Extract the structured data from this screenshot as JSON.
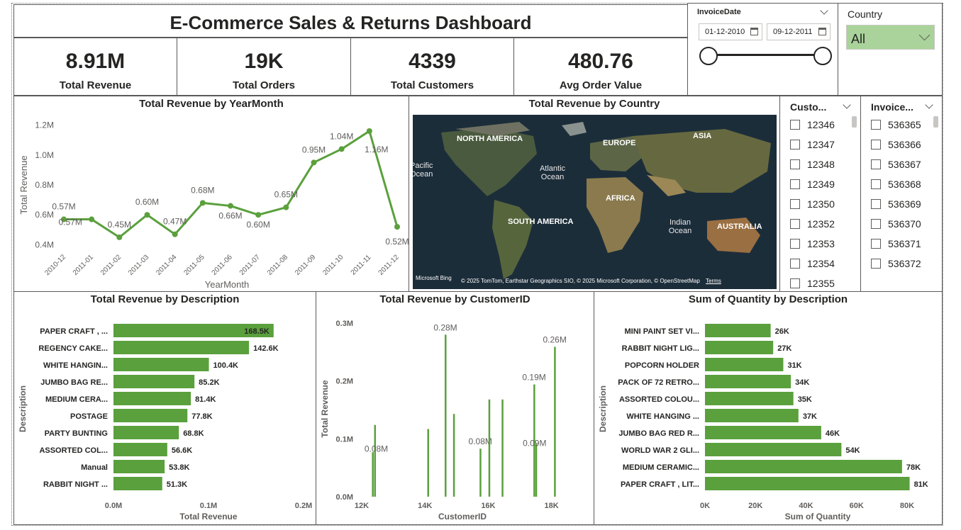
{
  "dashboard": {
    "title": "E-Commerce Sales & Returns Dashboard",
    "accent_color": "#5aa03c",
    "kpis": [
      {
        "value": "8.91M",
        "label": "Total Revenue"
      },
      {
        "value": "19K",
        "label": "Total Orders"
      },
      {
        "value": "4339",
        "label": "Total Customers"
      },
      {
        "value": "480.76",
        "label": "Avg Order Value"
      }
    ]
  },
  "slicers": {
    "invoice_date": {
      "label": "InvoiceDate",
      "start": "01-12-2010",
      "end": "09-12-2011",
      "icon": "calendar-icon",
      "range_fraction": [
        0,
        1
      ]
    },
    "country": {
      "label": "Country",
      "selected": "All",
      "icon": "chevron-down-icon"
    },
    "customer": {
      "label": "Custo...",
      "items": [
        "12346",
        "12347",
        "12348",
        "12349",
        "12350",
        "12352",
        "12353",
        "12354",
        "12355"
      ]
    },
    "invoice": {
      "label": "Invoice...",
      "items": [
        "536365",
        "536366",
        "536367",
        "536368",
        "536369",
        "536370",
        "536371",
        "536372"
      ]
    }
  },
  "map": {
    "title": "Total Revenue by Country",
    "labels": [
      "NORTH AMERICA",
      "EUROPE",
      "ASIA",
      "Pacific Ocean",
      "Atlantic Ocean",
      "AFRICA",
      "SOUTH AMERICA",
      "Indian Ocean",
      "AUSTRALIA"
    ],
    "brand": "Microsoft Bing",
    "attribution": "© 2025 TomTom, Earthstar Geographics SIO, © 2025 Microsoft Corporation, © OpenStreetMap",
    "terms": "Terms"
  },
  "chart_data": [
    {
      "type": "line",
      "title": "Total Revenue by YearMonth",
      "xlabel": "YearMonth",
      "ylabel": "Total Revenue",
      "categories": [
        "2010-12",
        "2011-01",
        "2011-02",
        "2011-03",
        "2011-04",
        "2011-05",
        "2011-06",
        "2011-07",
        "2011-08",
        "2011-09",
        "2011-10",
        "2011-11",
        "2011-12"
      ],
      "values": [
        0.57,
        0.57,
        0.45,
        0.6,
        0.47,
        0.68,
        0.66,
        0.6,
        0.65,
        0.95,
        1.04,
        1.16,
        0.52
      ],
      "data_labels": [
        "0.57M",
        "0.57M",
        "0.45M",
        "0.60M",
        "0.47M",
        "0.68M",
        "0.66M",
        "0.60M",
        "0.65M",
        "0.95M",
        "1.04M",
        "1.16M",
        "0.52M"
      ],
      "yticks": [
        "0.4M",
        "0.6M",
        "0.8M",
        "1.0M",
        "1.2M"
      ],
      "ytick_values": [
        0.4,
        0.6,
        0.8,
        1.0,
        1.2
      ],
      "ylim": [
        0.35,
        1.25
      ],
      "color": "#5aa03c"
    },
    {
      "type": "bar",
      "orientation": "horizontal",
      "title": "Total Revenue by Description",
      "xlabel": "Total Revenue",
      "ylabel": "Description",
      "categories": [
        "PAPER CRAFT , ...",
        "REGENCY CAKE...",
        "WHITE HANGIN...",
        "JUMBO BAG RE...",
        "MEDIUM CERA...",
        "POSTAGE",
        "PARTY BUNTING",
        "ASSORTED COL...",
        "Manual",
        "RABBIT NIGHT ..."
      ],
      "values": [
        168.5,
        142.6,
        100.4,
        85.2,
        81.4,
        77.8,
        68.8,
        56.6,
        53.8,
        51.3
      ],
      "value_unit": "K",
      "data_labels": [
        "168.5K",
        "142.6K",
        "100.4K",
        "85.2K",
        "81.4K",
        "77.8K",
        "68.8K",
        "56.6K",
        "53.8K",
        "51.3K"
      ],
      "xticks": [
        "0.0M",
        "0.1M",
        "0.2M"
      ],
      "xtick_values": [
        0,
        100,
        200
      ],
      "xlim": [
        0,
        200
      ],
      "color": "#5aa03c"
    },
    {
      "type": "bar",
      "title": "Total Revenue by CustomerID",
      "xlabel": "CustomerID",
      "ylabel": "Total Revenue",
      "x": [
        12346,
        12415,
        14096,
        14646,
        14911,
        15749,
        16029,
        16446,
        17450,
        17511,
        18102
      ],
      "values": [
        0.077,
        0.124,
        0.117,
        0.28,
        0.143,
        0.083,
        0.168,
        0.168,
        0.194,
        0.091,
        0.259
      ],
      "data_labels": [
        "",
        "0.08M",
        "",
        "0.28M",
        "",
        "0.08M",
        "",
        "",
        "0.19M",
        "0.09M",
        "0.26M"
      ],
      "xticks": [
        "12K",
        "14K",
        "16K",
        "18K"
      ],
      "xtick_values": [
        12000,
        14000,
        16000,
        18000
      ],
      "yticks": [
        "0.0M",
        "0.1M",
        "0.2M",
        "0.3M"
      ],
      "ytick_values": [
        0,
        0.1,
        0.2,
        0.3
      ],
      "xlim": [
        12000,
        18300
      ],
      "ylim": [
        0,
        0.3
      ],
      "color": "#5aa03c"
    },
    {
      "type": "bar",
      "orientation": "horizontal",
      "title": "Sum of Quantity by Description",
      "xlabel": "Sum of Quantity",
      "ylabel": "Description",
      "categories": [
        "MINI PAINT SET VI...",
        "RABBIT NIGHT LIG...",
        "POPCORN HOLDER",
        "PACK OF 72 RETRO...",
        "ASSORTED COLOU...",
        "WHITE HANGING ...",
        "JUMBO BAG RED R...",
        "WORLD WAR 2 GLI...",
        "MEDIUM CERAMIC...",
        "PAPER CRAFT , LIT..."
      ],
      "values": [
        26,
        27,
        31,
        34,
        35,
        37,
        46,
        54,
        78,
        81
      ],
      "value_unit": "K",
      "data_labels": [
        "26K",
        "27K",
        "31K",
        "34K",
        "35K",
        "37K",
        "46K",
        "54K",
        "78K",
        "81K"
      ],
      "xticks": [
        "0K",
        "20K",
        "40K",
        "60K",
        "80K"
      ],
      "xtick_values": [
        0,
        20,
        40,
        60,
        80
      ],
      "xlim": [
        0,
        80
      ],
      "color": "#5aa03c"
    }
  ]
}
